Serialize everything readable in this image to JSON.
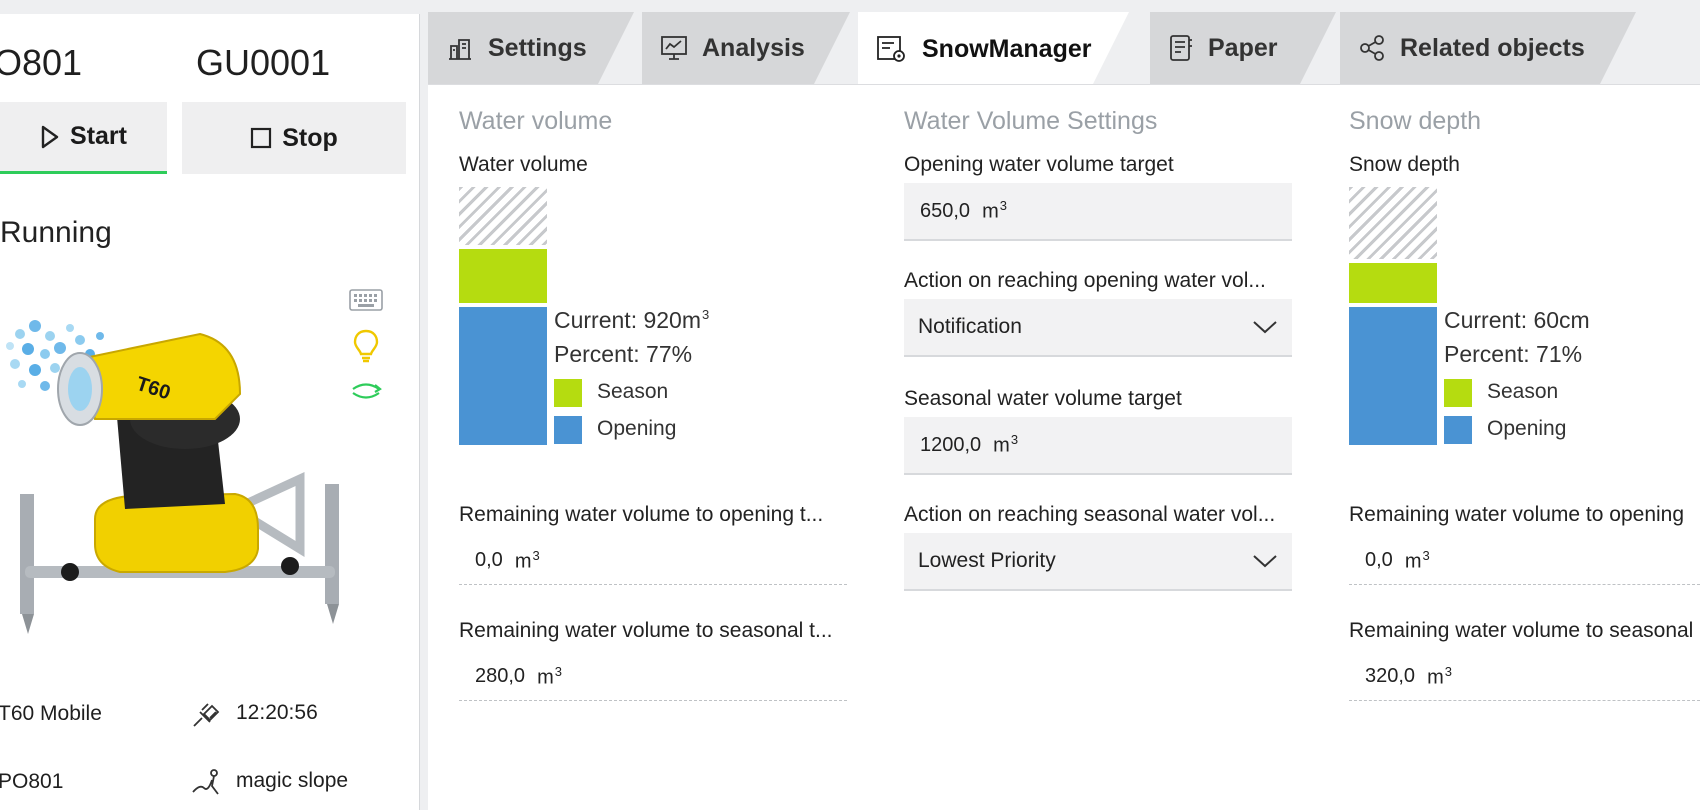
{
  "left": {
    "id_1": "O801",
    "id_2": "GU0001",
    "start_label": "Start",
    "stop_label": "Stop",
    "status": "Running",
    "device_badge": "T60",
    "model": "T60 Mobile",
    "time": "12:20:56",
    "location_id": "PO801",
    "slope": "magic slope"
  },
  "tabs": [
    {
      "label": "Settings",
      "icon": "settings-icon"
    },
    {
      "label": "Analysis",
      "icon": "analysis-icon"
    },
    {
      "label": "SnowManager",
      "icon": "snowmanager-icon",
      "active": true
    },
    {
      "label": "Paper",
      "icon": "paper-icon"
    },
    {
      "label": "Related objects",
      "icon": "related-objects-icon"
    }
  ],
  "water_volume": {
    "section_title": "Water volume",
    "chart_label": "Water volume",
    "current": "Current: 920m",
    "current_unit_sup": "3",
    "percent": "Percent: 77%",
    "legend_season": "Season",
    "legend_opening": "Opening",
    "remaining_opening_label": "Remaining water volume to opening t...",
    "remaining_opening_value": "0,0",
    "remaining_opening_unit": "m",
    "remaining_seasonal_label": "Remaining water volume to seasonal t...",
    "remaining_seasonal_value": "280,0",
    "remaining_seasonal_unit": "m"
  },
  "settings": {
    "section_title": "Water Volume Settings",
    "opening_target_label": "Opening water volume target",
    "opening_target_value": "650,0",
    "opening_target_unit": "m",
    "opening_action_label": "Action on reaching opening water vol...",
    "opening_action_value": "Notification",
    "seasonal_target_label": "Seasonal water volume target",
    "seasonal_target_value": "1200,0",
    "seasonal_target_unit": "m",
    "seasonal_action_label": "Action on reaching seasonal water vol...",
    "seasonal_action_value": "Lowest Priority"
  },
  "snow_depth": {
    "section_title": "Snow depth",
    "chart_label": "Snow depth",
    "current": "Current: 60cm",
    "percent": "Percent: 71%",
    "legend_season": "Season",
    "legend_opening": "Opening",
    "remaining_opening_label": "Remaining water volume to opening",
    "remaining_opening_value": "0,0",
    "remaining_opening_unit": "m",
    "remaining_seasonal_label": "Remaining water volume to seasonal",
    "remaining_seasonal_value": "320,0",
    "remaining_seasonal_unit": "m"
  },
  "colors": {
    "season": "#b5dc10",
    "opening": "#4a93d3",
    "start_underline": "#2ecc5a"
  }
}
